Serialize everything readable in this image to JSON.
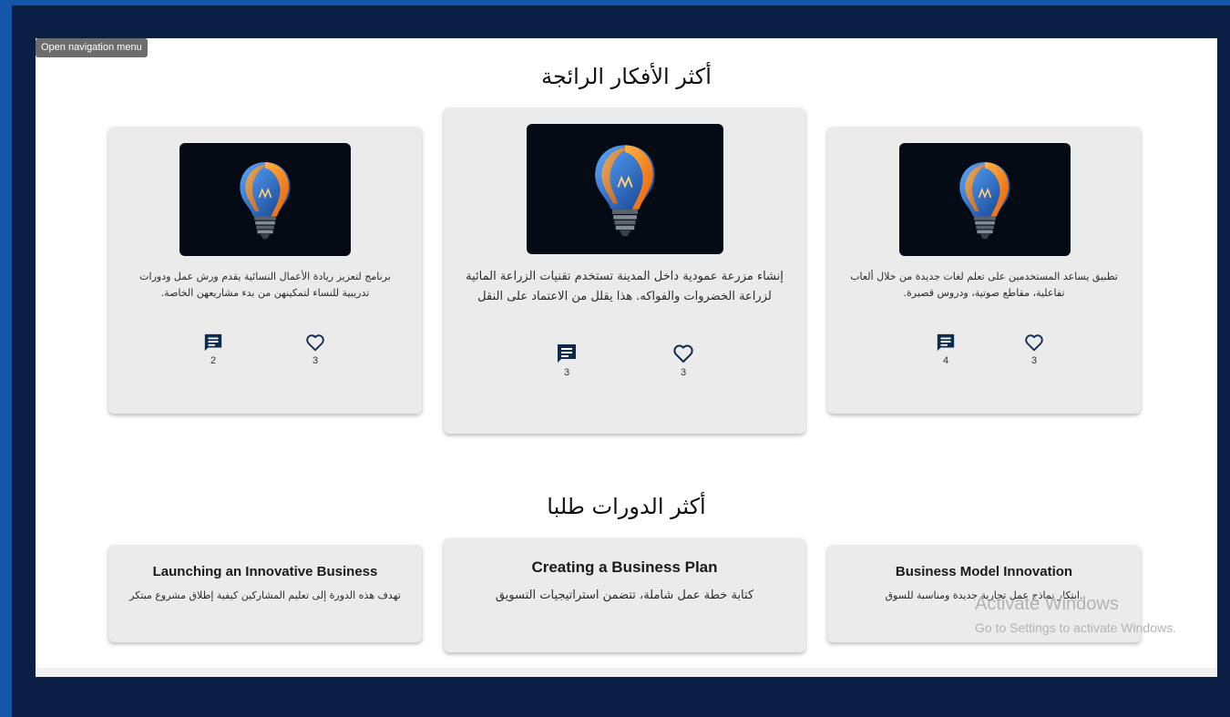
{
  "nav": {
    "tooltip": "Open navigation menu"
  },
  "ideas": {
    "title": "أكثر الأفكار الرائجة",
    "cards": [
      {
        "description": "تطبيق يساعد المستخدمين على تعلم لغات جديدة من خلال ألعاب تفاعلية، مقاطع صوتية، ودروس قصيرة.",
        "comments": "4",
        "likes": "3"
      },
      {
        "description": "إنشاء مزرعة عمودية داخل المدينة تستخدم تقنيات الزراعة المائية لزراعة الخضروات والفواكه. هذا يقلل من الاعتماد على النقل",
        "comments": "3",
        "likes": "3"
      },
      {
        "description": "برنامج لتعزيز ريادة الأعمال النسائية يقدم ورش عمل ودورات تدريبية للنساء لتمكينهن من بدء مشاريعهن الخاصة.",
        "comments": "2",
        "likes": "3"
      }
    ]
  },
  "courses": {
    "title": "أكثر الدورات طلبا",
    "cards": [
      {
        "title": "Business Model Innovation",
        "description": ".ابتكار نماذج عمل تجارية جديدة ومناسبة للسوق"
      },
      {
        "title": "Creating a Business Plan",
        "description": "كتابة خطة عمل شاملة، تتضمن استراتيجيات التسويق"
      },
      {
        "title": "Launching an Innovative Business",
        "description": "تهدف هذه الدورة إلى تعليم المشاركين كيفية إطلاق مشروع مبتكر"
      }
    ]
  },
  "watermark": {
    "line1": "Activate Windows",
    "line2": "Go to Settings to activate Windows."
  },
  "icons": {
    "comment": "comment-icon",
    "like": "heart-outline-icon",
    "idea": "lightbulb-icon"
  },
  "colors": {
    "comment_icon": "#0d2a4f",
    "heart_icon": "#0d2a4f",
    "card_bg": "#ebebeb",
    "frame": "#0b1f44"
  }
}
